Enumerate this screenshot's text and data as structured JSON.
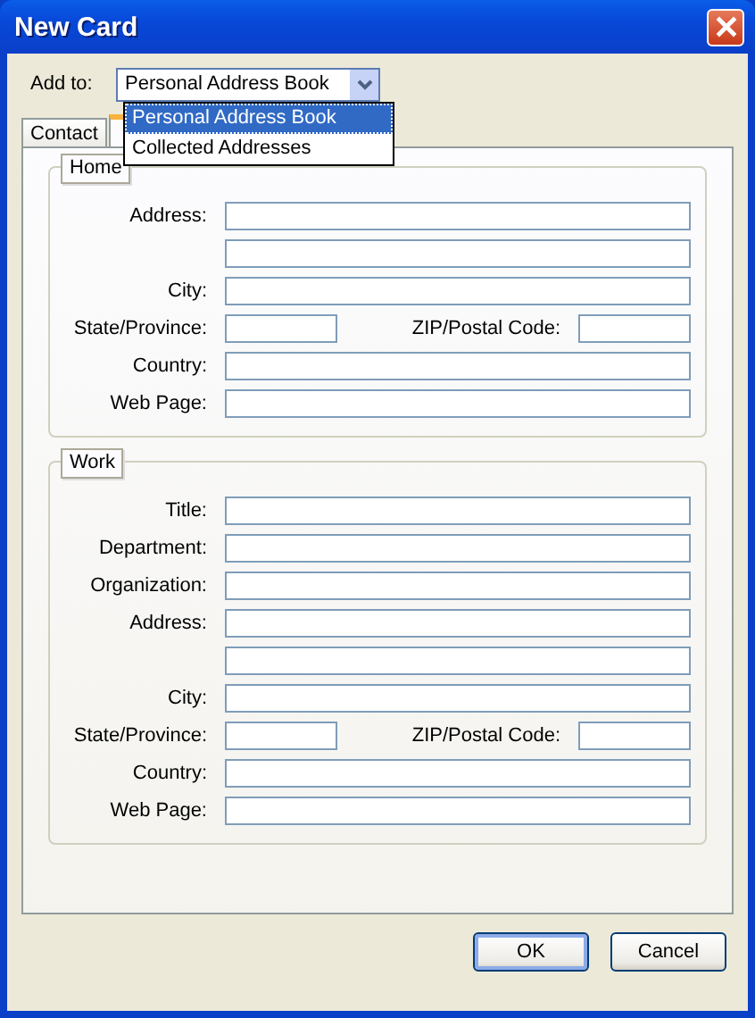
{
  "window": {
    "title": "New Card"
  },
  "add_to": {
    "label": "Add to:",
    "value": "Personal Address Book",
    "expanded": true,
    "options": [
      {
        "label": "Personal Address Book",
        "selected": true
      },
      {
        "label": "Collected Addresses",
        "selected": false
      }
    ]
  },
  "tabs": [
    {
      "label": "Contact",
      "selected": false
    },
    {
      "selected": true
    }
  ],
  "groups": [
    {
      "title": "Home",
      "rows": [
        {
          "kind": "full",
          "label": "Address:"
        },
        {
          "kind": "continuation"
        },
        {
          "kind": "full",
          "label": "City:"
        },
        {
          "kind": "split",
          "label": "State/Province:",
          "label_2": "ZIP/Postal Code:"
        },
        {
          "kind": "full",
          "label": "Country:"
        },
        {
          "kind": "full",
          "label": "Web Page:"
        }
      ]
    },
    {
      "title": "Work",
      "rows": [
        {
          "kind": "full",
          "label": "Title:"
        },
        {
          "kind": "full",
          "label": "Department:"
        },
        {
          "kind": "full",
          "label": "Organization:"
        },
        {
          "kind": "full",
          "label": "Address:"
        },
        {
          "kind": "continuation"
        },
        {
          "kind": "full",
          "label": "City:"
        },
        {
          "kind": "split",
          "label": "State/Province:",
          "label_2": "ZIP/Postal Code:"
        },
        {
          "kind": "full",
          "label": "Country:"
        },
        {
          "kind": "full",
          "label": "Web Page:"
        }
      ]
    }
  ],
  "buttons": [
    {
      "label": "OK",
      "default": true
    },
    {
      "label": "Cancel",
      "default": false
    }
  ]
}
